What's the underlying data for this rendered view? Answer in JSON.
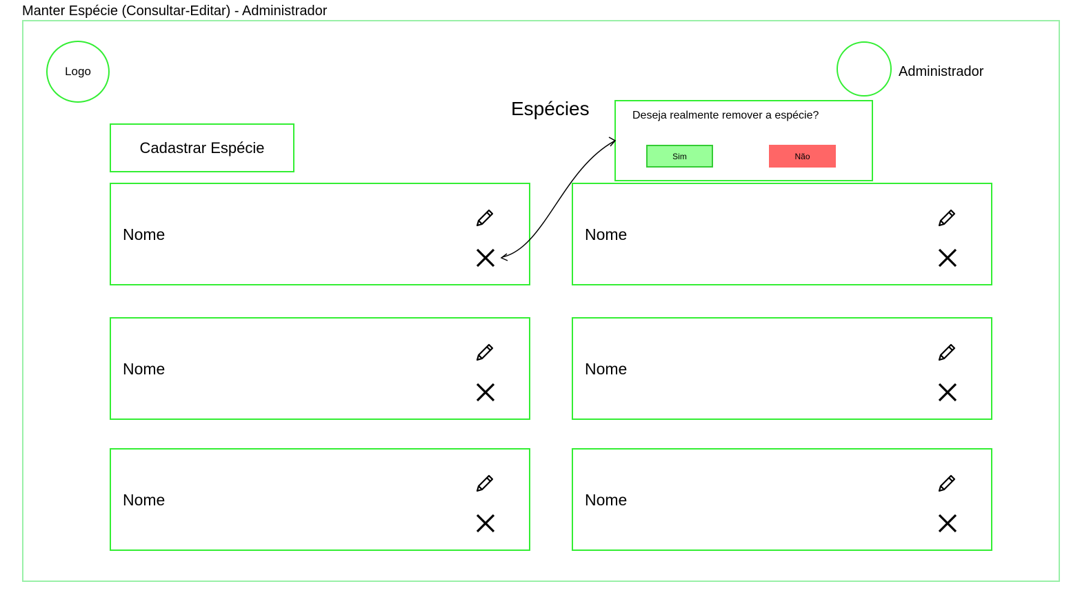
{
  "page": {
    "title": "Manter Espécie (Consultar-Editar) - Administrador"
  },
  "header": {
    "logo_label": "Logo",
    "user_name": "Administrador"
  },
  "main": {
    "section_title": "Espécies",
    "add_button_label": "Cadastrar Espécie",
    "cards": [
      {
        "name": "Nome",
        "edit_icon": "pencil-icon",
        "delete_icon": "close-icon"
      },
      {
        "name": "Nome",
        "edit_icon": "pencil-icon",
        "delete_icon": "close-icon"
      },
      {
        "name": "Nome",
        "edit_icon": "pencil-icon",
        "delete_icon": "close-icon"
      },
      {
        "name": "Nome",
        "edit_icon": "pencil-icon",
        "delete_icon": "close-icon"
      },
      {
        "name": "Nome",
        "edit_icon": "pencil-icon",
        "delete_icon": "close-icon"
      },
      {
        "name": "Nome",
        "edit_icon": "pencil-icon",
        "delete_icon": "close-icon"
      }
    ]
  },
  "confirm_dialog": {
    "message": "Deseja realmente remover a espécie?",
    "yes_label": "Sim",
    "no_label": "Não"
  },
  "colors": {
    "border_accent": "#33ee33",
    "frame_border": "#99f0a8",
    "yes_button": "#99ff99",
    "no_button": "#ff6666"
  }
}
